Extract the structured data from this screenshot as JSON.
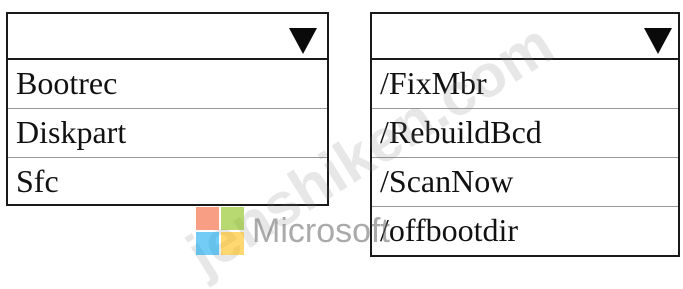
{
  "left_dropdown": {
    "selected": "",
    "options": [
      "Bootrec",
      "Diskpart",
      "Sfc"
    ]
  },
  "right_dropdown": {
    "selected": "",
    "options": [
      "/FixMbr",
      "/RebuildBcd",
      "/ScanNow",
      "/offbootdir"
    ]
  },
  "watermark": {
    "site_text": "jenshiken.com",
    "brand_text": "Microsoft"
  },
  "icons": {
    "dropdown_arrow": "caret-down-icon",
    "brand_logo": "microsoft-logo-icon"
  },
  "colors": {
    "border": "#1a1a1a",
    "background": "#ffffff",
    "text": "#111111"
  }
}
